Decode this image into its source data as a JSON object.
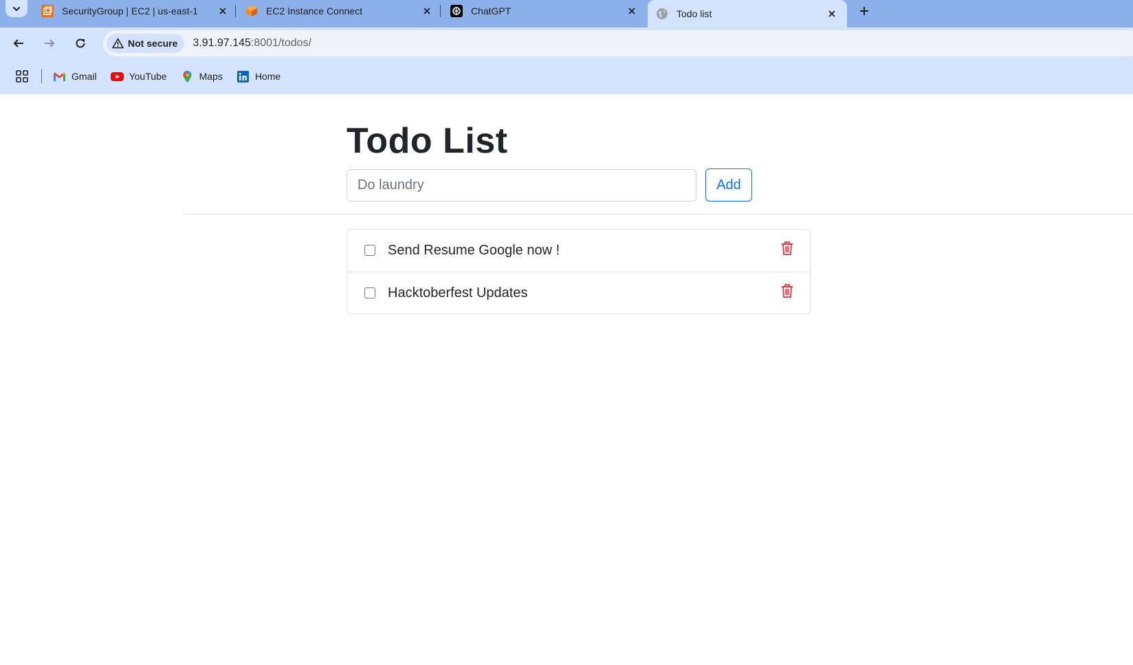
{
  "browser": {
    "tabs": [
      {
        "title": "SecurityGroup | EC2 | us-east-1",
        "icon": "aws-ec2-icon",
        "active": false
      },
      {
        "title": "EC2 Instance Connect",
        "icon": "aws-cube-icon",
        "active": false
      },
      {
        "title": "ChatGPT",
        "icon": "chatgpt-icon",
        "active": false
      },
      {
        "title": "Todo list",
        "icon": "globe-icon",
        "active": true
      }
    ],
    "security_chip": "Not secure",
    "url_host": "3.91.97.145",
    "url_rest": ":8001/todos/",
    "bookmarks": [
      {
        "label": "Gmail",
        "icon": "gmail-icon"
      },
      {
        "label": "YouTube",
        "icon": "youtube-icon"
      },
      {
        "label": "Maps",
        "icon": "maps-icon"
      },
      {
        "label": "Home",
        "icon": "linkedin-icon"
      }
    ]
  },
  "app": {
    "title": "Todo List",
    "input_placeholder": "Do laundry",
    "add_label": "Add",
    "todos": [
      {
        "text": "Send Resume Google now !",
        "done": false
      },
      {
        "text": "Hacktoberfest Updates",
        "done": false
      }
    ],
    "colors": {
      "primary": "#0d6efd",
      "danger": "#dc3545"
    }
  }
}
